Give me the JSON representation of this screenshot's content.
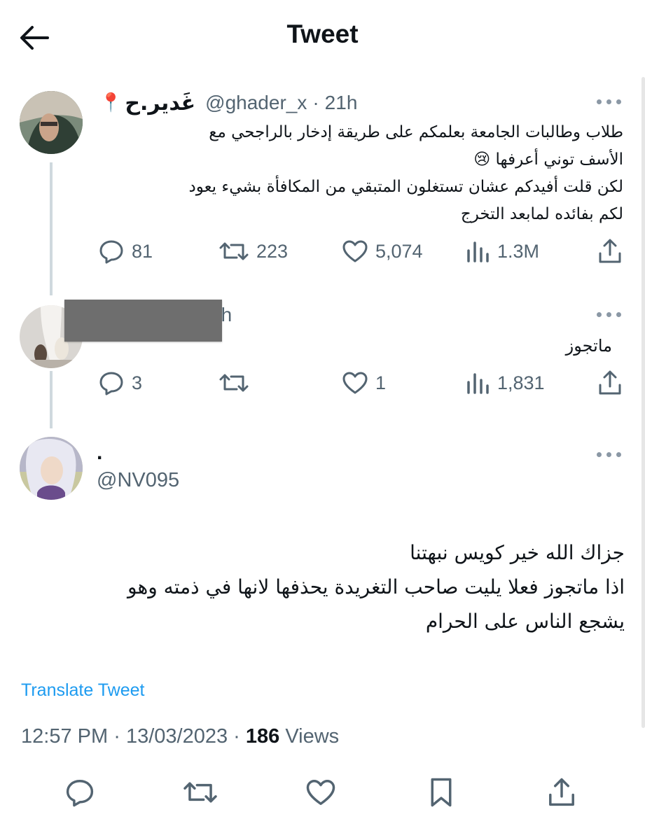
{
  "header": {
    "title": "Tweet"
  },
  "original_tweet": {
    "display_name": "غَدير.ح",
    "name_emoji": "📍",
    "handle": "@ghader_x",
    "separator": "·",
    "time": "21h",
    "text_lines": [
      "طلاب وطالبات الجامعة بعلمكم على طريقة إدخار بالراجحي مع",
      "الأسف توني أعرفها 😢",
      "لكن قلت أفيدكم عشان تستغلون المتبقي من المكافأة بشيء يعود",
      "لكم بفائده لمابعد التخرج"
    ],
    "replies": "81",
    "retweets": "223",
    "likes": "5,074",
    "views": "1.3M"
  },
  "reply_tweet": {
    "time_fragment": "3h",
    "text": "ماتجوز",
    "replies": "3",
    "retweets": "",
    "likes": "1",
    "views": "1,831"
  },
  "main_tweet": {
    "display_name": ".",
    "handle": "@NV095",
    "text_lines": [
      "جزاك الله خير كويس نبهتنا",
      "اذا ماتجوز فعلا يليت صاحب التغريدة يحذفها لانها في ذمته وهو",
      "يشجع الناس على الحرام"
    ],
    "translate_label": "Translate Tweet",
    "time": "12:57 PM",
    "date": "13/03/2023",
    "views_count": "186",
    "views_label": "Views",
    "dot": "·"
  },
  "icons": {
    "back": "back-arrow-icon",
    "more": "more-icon",
    "reply": "reply-icon",
    "retweet": "retweet-icon",
    "like": "like-icon",
    "views": "views-icon",
    "share": "share-icon",
    "bookmark": "bookmark-icon"
  },
  "colors": {
    "link": "#1d9bf0",
    "muted": "#536471",
    "text": "#0f1419",
    "thread_line": "#cfd9de"
  }
}
